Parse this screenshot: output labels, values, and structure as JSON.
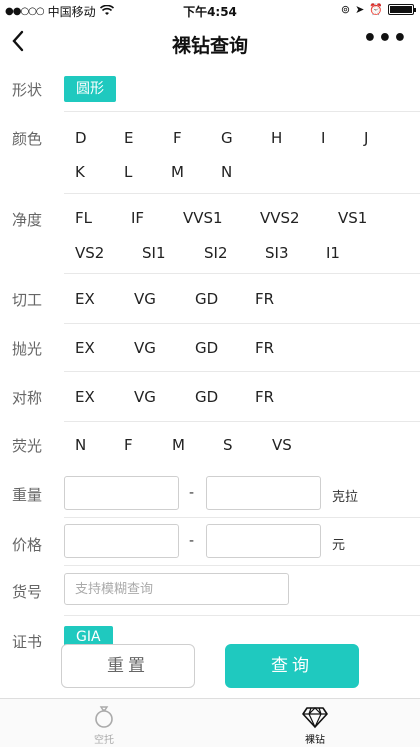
{
  "status": {
    "carrier": "中国移动",
    "time": "下午4:54"
  },
  "nav": {
    "title": "裸钻查询"
  },
  "shape": {
    "label": "形状",
    "selected": "圆形"
  },
  "color": {
    "label": "颜色",
    "options": [
      "D",
      "E",
      "F",
      "G",
      "H",
      "I",
      "J",
      "K",
      "L",
      "M",
      "N"
    ]
  },
  "clarity": {
    "label": "净度",
    "options": [
      "FL",
      "IF",
      "VVS1",
      "VVS2",
      "VS1",
      "VS2",
      "SI1",
      "SI2",
      "SI3",
      "I1"
    ]
  },
  "cut": {
    "label": "切工",
    "options": [
      "EX",
      "VG",
      "GD",
      "FR"
    ]
  },
  "polish": {
    "label": "抛光",
    "options": [
      "EX",
      "VG",
      "GD",
      "FR"
    ]
  },
  "symmetry": {
    "label": "对称",
    "options": [
      "EX",
      "VG",
      "GD",
      "FR"
    ]
  },
  "fluorescence": {
    "label": "荧光",
    "options": [
      "N",
      "F",
      "M",
      "S",
      "VS"
    ]
  },
  "weight": {
    "label": "重量",
    "sep": "-",
    "unit": "克拉"
  },
  "price": {
    "label": "价格",
    "sep": "-",
    "unit": "元"
  },
  "sku": {
    "label": "货号",
    "placeholder": "支持模糊查询"
  },
  "cert": {
    "label": "证书",
    "selected": "GIA"
  },
  "actions": {
    "reset": "重置",
    "query": "查询"
  },
  "tabs": [
    {
      "label": "空托",
      "icon": "ring-icon",
      "active": false
    },
    {
      "label": "裸钻",
      "icon": "diamond-icon",
      "active": true
    }
  ],
  "colors": {
    "accent": "#1fc9bf"
  }
}
